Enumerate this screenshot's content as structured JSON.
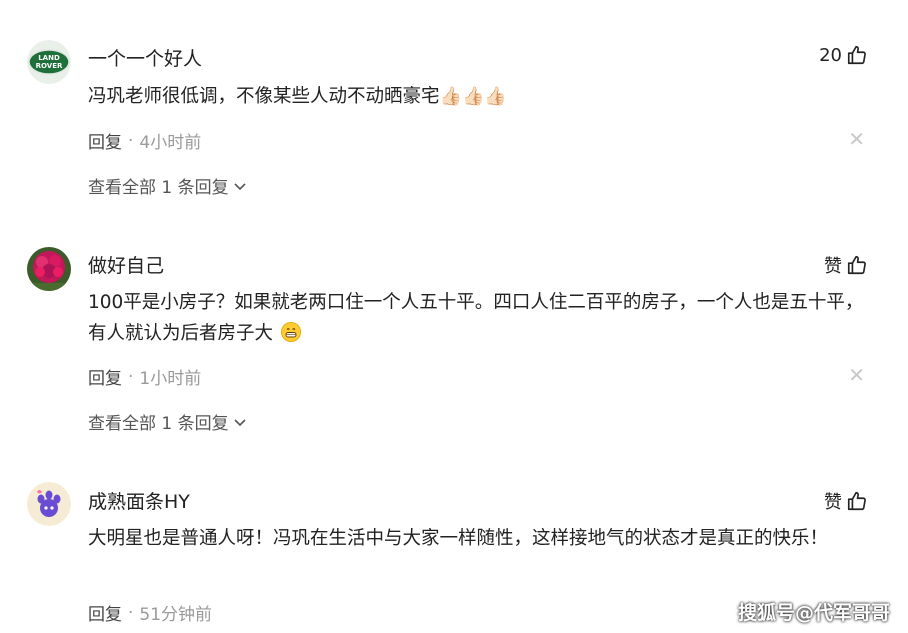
{
  "comments": [
    {
      "username": "一个一个好人",
      "like_label": "20",
      "text": "冯巩老师很低调，不像某些人动不动晒豪宅",
      "emojis": [
        "👍🏻",
        "👍🏻",
        "👍🏻"
      ],
      "reply_label": "回复",
      "time": "4小时前",
      "view_all": "查看全部 1 条回复",
      "avatar_icon": "land-rover-logo-icon",
      "avatar_logo_top": "LAND",
      "avatar_logo_bottom": "ROVER"
    },
    {
      "username": "做好自己",
      "like_label": "赞",
      "text": "100平是小房子？如果就老两口住一个人五十平。四口人住二百平的房子，一个人也是五十平，有人就认为后者房子大",
      "reply_label": "回复",
      "time": "1小时前",
      "view_all": "查看全部 1 条回复",
      "avatar_icon": "flower-photo-icon"
    },
    {
      "username": "成熟面条HY",
      "like_label": "赞",
      "text": "大明星也是普通人呀！冯巩在生活中与大家一样随性，这样接地气的状态才是真正的快乐！",
      "reply_label": "回复",
      "time": "51分钟前",
      "avatar_icon": "purple-paw-icon"
    }
  ],
  "watermark": "搜狐号@代军哥哥",
  "colors": {
    "text": "#222222",
    "meta": "#9a9a9a",
    "close": "#c8c8c8"
  }
}
